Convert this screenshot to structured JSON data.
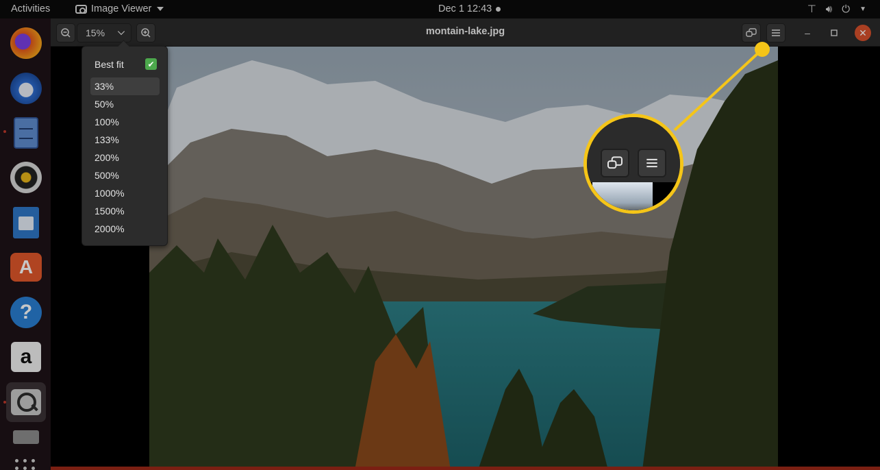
{
  "topbar": {
    "activities": "Activities",
    "app_name": "Image Viewer",
    "clock": "Dec 1  12:43",
    "tray_icons": [
      "network-icon",
      "volume-icon",
      "power-icon"
    ]
  },
  "dock": {
    "apps": [
      "firefox",
      "thunderbird",
      "files",
      "rhythmbox",
      "libreoffice-writer",
      "ubuntu-software",
      "help",
      "amazon",
      "image-viewer",
      "disk"
    ]
  },
  "window": {
    "title": "montain-lake.jpg",
    "zoom_value": "15%"
  },
  "zoom_menu": {
    "best_fit_label": "Best fit",
    "best_fit_checked": true,
    "levels": [
      "33%",
      "50%",
      "100%",
      "133%",
      "200%",
      "500%",
      "1000%",
      "1500%",
      "2000%"
    ],
    "hovered": "33%"
  },
  "colors": {
    "callout": "#f5c518",
    "close_button": "#d9512c",
    "check": "#4ca84c"
  }
}
